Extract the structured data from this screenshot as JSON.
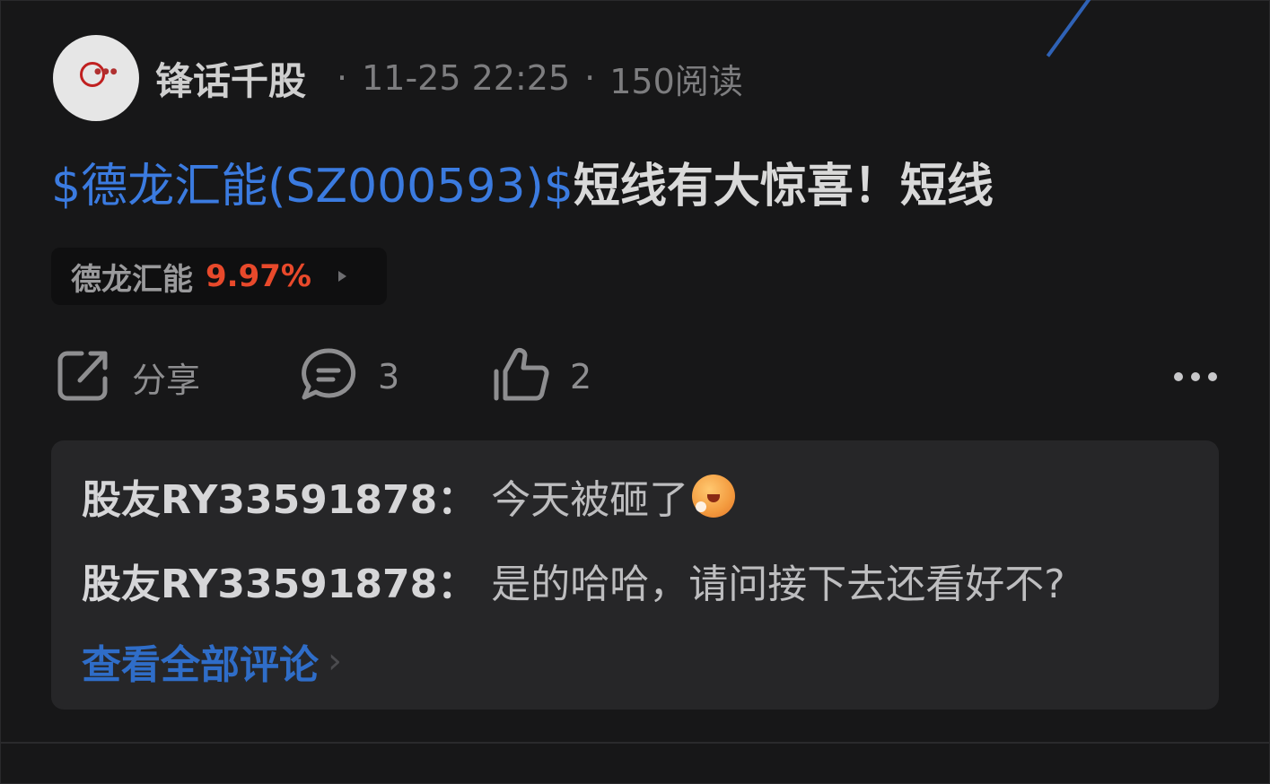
{
  "post": {
    "author": "锋话千股",
    "timestamp": "11-25 22:25",
    "reads": "150阅读",
    "separator": "·",
    "stock_link": "$德龙汇能(SZ000593)$",
    "body_text": "短线有大惊喜！短线"
  },
  "stock_chip": {
    "name": "德龙汇能",
    "change_pct": "9.97%"
  },
  "actions": {
    "share_label": "分享",
    "comment_count": "3",
    "like_count": "2"
  },
  "comments": {
    "items": [
      {
        "user": "股友RY33591878",
        "text": "今天被砸了"
      },
      {
        "user": "股友RY33591878",
        "text": "是的哈哈，请问接下去还看好不?"
      }
    ],
    "colon": "：",
    "view_all": "查看全部评论",
    "chevron": "›"
  },
  "colors": {
    "link_blue": "#3b7be0",
    "gain_red": "#e8492b",
    "background": "#171718"
  },
  "icons": [
    "share-icon",
    "comment-icon",
    "thumbs-up-icon",
    "more-icon",
    "chevron-right-icon"
  ]
}
